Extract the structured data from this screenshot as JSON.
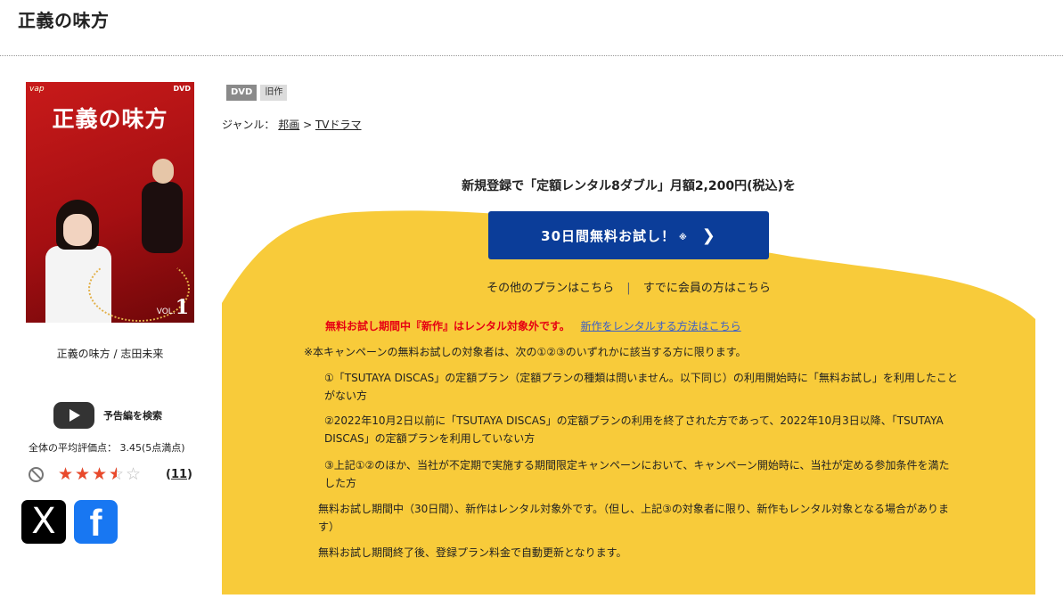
{
  "title": "正義の味方",
  "jacket": {
    "title": "正義の味方",
    "label": "DVD",
    "logo": "vap",
    "vol_text": "VOL.",
    "vol_num": "1"
  },
  "caption": "正義の味方 / 志田未来",
  "trailer_label": "予告編を検索",
  "rating": {
    "text": "全体の平均評価点： 3.45(5点満点)",
    "value": 3.45,
    "max": 5,
    "count": "11"
  },
  "social": {
    "x_label": "X",
    "fb_label": "f"
  },
  "badges": [
    "DVD",
    "旧作"
  ],
  "genre": {
    "label": "ジャンル：",
    "items": [
      "邦画",
      "TVドラマ"
    ],
    "separator": ">"
  },
  "promo": {
    "headline": "新規登録で「定額レンタル8ダブル」月額2,200円(税込)を",
    "cta": "30日間無料お試し！",
    "cta_note": "※",
    "link_other": "その他のプランはこちら",
    "link_member": "すでに会員の方はこちら",
    "link_sep": "|",
    "warning": "無料お試し期間中『新作』はレンタル対象外です。",
    "warning_link": "新作をレンタルする方法はこちら",
    "note_intro": "※本キャンペーンの無料お試しの対象者は、次の①②③のいずれかに該当する方に限ります。",
    "cond1": "①「TSUTAYA DISCAS」の定額プラン（定額プランの種類は問いません。以下同じ）の利用開始時に「無料お試し」を利用したことがない方",
    "cond2": "②2022年10月2日以前に「TSUTAYA DISCAS」の定額プランの利用を終了された方であって、2022年10月3日以降、「TSUTAYA DISCAS」の定額プランを利用していない方",
    "cond3": "③上記①②のほか、当社が不定期で実施する期間限定キャンペーンにおいて、キャンペーン開始時に、当社が定める参加条件を満たした方",
    "note_period": "無料お試し期間中（30日間）、新作はレンタル対象外です。（但し、上記③の対象者に限り、新作もレンタル対象となる場合があります）",
    "note_renew": "無料お試し期間終了後、登録プラン料金で自動更新となります。"
  },
  "colors": {
    "promo_bg": "#f8cb3a",
    "cta_bg": "#0b3d99",
    "warning": "#e60012",
    "link": "#3a5ec8",
    "star": "#e9492b"
  }
}
